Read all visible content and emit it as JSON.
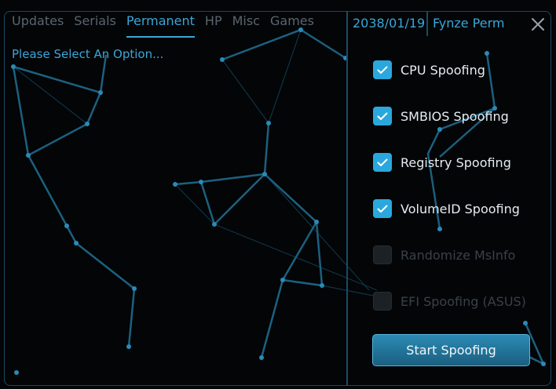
{
  "tabs": [
    {
      "label": "Updates",
      "active": false
    },
    {
      "label": "Serials",
      "active": false
    },
    {
      "label": "Permanent",
      "active": true
    },
    {
      "label": "HP",
      "active": false
    },
    {
      "label": "Misc",
      "active": false
    },
    {
      "label": "Games",
      "active": false
    }
  ],
  "header": {
    "date": "2038/01/19",
    "product": "Fynze Perm",
    "close_icon": "close-icon"
  },
  "prompt": "Please Select An Option...",
  "options": [
    {
      "label": "CPU Spoofing",
      "checked": true,
      "enabled": true
    },
    {
      "label": "SMBIOS Spoofing",
      "checked": true,
      "enabled": true
    },
    {
      "label": "Registry Spoofing",
      "checked": true,
      "enabled": true
    },
    {
      "label": "VolumeID Spoofing",
      "checked": true,
      "enabled": true
    },
    {
      "label": "Randomize MsInfo",
      "checked": false,
      "enabled": false
    },
    {
      "label": "EFI Spoofing (ASUS)",
      "checked": false,
      "enabled": false
    }
  ],
  "start_button": "Start Spoofing",
  "colors": {
    "accent": "#3aa6d8",
    "border": "#1a4a66",
    "background": "#030507",
    "tab_inactive": "#5b6570"
  }
}
